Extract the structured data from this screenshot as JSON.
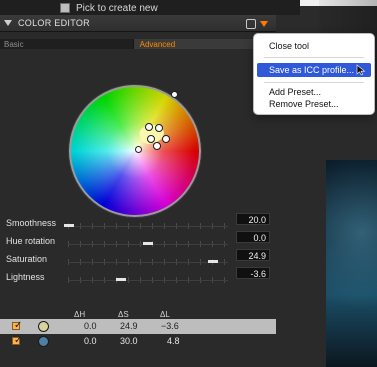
{
  "top": {
    "pick_to_create_new": "Pick to create new"
  },
  "editor": {
    "title": "COLOR EDITOR",
    "tabs": [
      {
        "label": "Basic"
      },
      {
        "label": "Advanced"
      }
    ]
  },
  "sliders": [
    {
      "label": "Smoothness",
      "value": "20.0",
      "level": 0.04
    },
    {
      "label": "Hue rotation",
      "value": "0.0",
      "level": 0.5
    },
    {
      "label": "Saturation",
      "value": "24.9",
      "level": 0.9
    },
    {
      "label": "Lightness",
      "value": "-3.6",
      "level": 0.33
    }
  ],
  "table": {
    "headers": [
      "ΔH",
      "ΔS",
      "ΔL"
    ],
    "rows": [
      {
        "checked": true,
        "swatch_color": "#d8d39a",
        "dh": "0.0",
        "ds": "24.9",
        "dl": "−3.6",
        "selected": true
      },
      {
        "checked": true,
        "swatch_color": "#4f7fa3",
        "dh": "0.0",
        "ds": "30.0",
        "dl": "4.8",
        "selected": false
      }
    ]
  },
  "menu": {
    "items": [
      {
        "label": "Close tool",
        "highlighted": false
      },
      {
        "label": "Save as ICC profile...",
        "highlighted": true
      },
      {
        "label": "Add Preset...",
        "highlighted": false
      },
      {
        "label": "Remove Preset...",
        "highlighted": false
      }
    ]
  },
  "colors": {
    "accent_orange": "#ff8a00",
    "menu_highlight": "#2f59d9",
    "panel_bg": "#2a2a2a"
  },
  "icons": {
    "header_icon": "window-icon",
    "header_arrow": "menu-arrow-icon",
    "dropper": "eyedropper-icon",
    "cursor": "mouse-pointer-icon"
  }
}
